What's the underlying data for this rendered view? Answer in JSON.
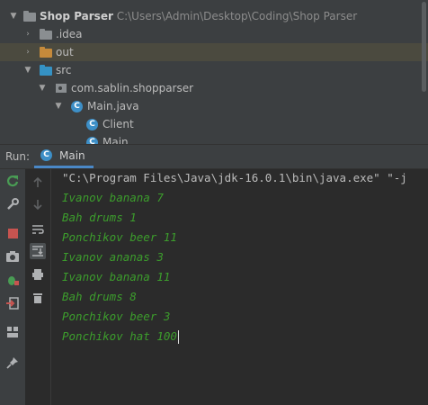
{
  "project": {
    "root": {
      "name": "Shop Parser",
      "path": "C:\\Users\\Admin\\Desktop\\Coding\\Shop Parser"
    },
    "items": [
      {
        "label": "idea"
      },
      {
        "label": "out"
      },
      {
        "label": "src"
      },
      {
        "label": "com.sablin.shopparser"
      },
      {
        "label": "Main.java"
      },
      {
        "label": "Client"
      },
      {
        "label": "Main"
      }
    ],
    "class_letter": "C"
  },
  "run": {
    "label": "Run:",
    "tab": "Main"
  },
  "console": {
    "command": "\"C:\\Program Files\\Java\\jdk-16.0.1\\bin\\java.exe\" \"-j",
    "lines": [
      "Ivanov banana 7",
      "Bah drums 1",
      "Ponchikov beer 11",
      "Ivanov ananas 3",
      "Ivanov banana 11",
      "Bah drums 8",
      "Ponchikov beer 3",
      "Ponchikov hat 100"
    ],
    "output_color": "#3c9d2c"
  },
  "colors": {
    "accent": "#4a88c7",
    "rerun_green": "#499c54",
    "stop_red": "#c75450",
    "folder_blue": "#3592c4",
    "folder_orange": "#c58a3b",
    "folder_gray": "#8a8e91"
  }
}
